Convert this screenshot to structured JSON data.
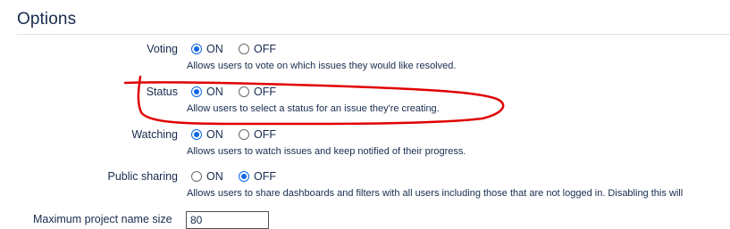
{
  "section": {
    "title": "Options"
  },
  "header_fragment": "",
  "options": [
    {
      "label": "Voting",
      "on_label": "ON",
      "off_label": "OFF",
      "selected": "on",
      "description": "Allows users to vote on which issues they would like resolved."
    },
    {
      "label": "Status",
      "on_label": "ON",
      "off_label": "OFF",
      "selected": "on",
      "description": "Allow users to select a status for an issue they're creating."
    },
    {
      "label": "Watching",
      "on_label": "ON",
      "off_label": "OFF",
      "selected": "on",
      "description": "Allows users to watch issues and keep notified of their progress."
    },
    {
      "label": "Public sharing",
      "on_label": "ON",
      "off_label": "OFF",
      "selected": "off",
      "description": "Allows users to share dashboards and filters with all users including those that are not logged in. Disabling this will"
    }
  ],
  "next_field": {
    "label": "Maximum project name size",
    "value": "80"
  },
  "annotation": {
    "color": "#e00000"
  }
}
